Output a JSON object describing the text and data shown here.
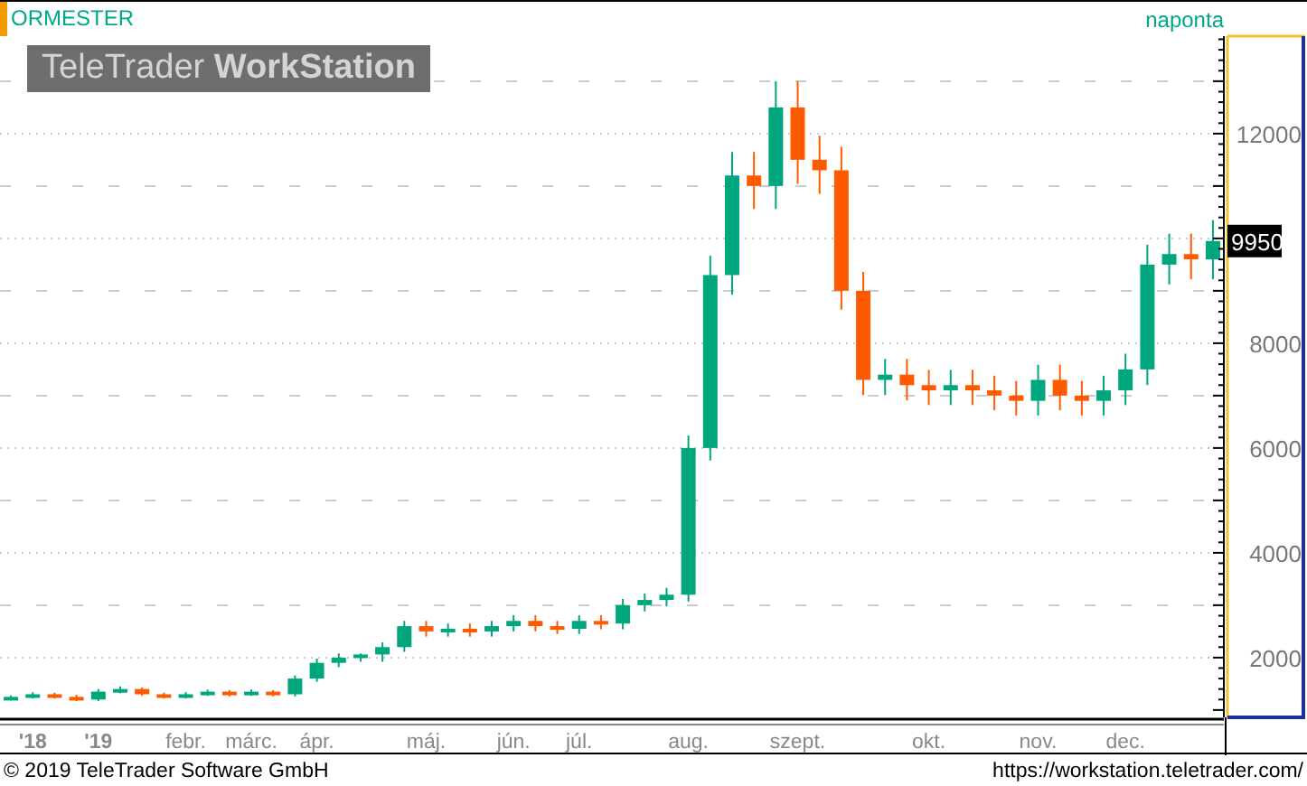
{
  "header": {
    "symbol": "ORMESTER",
    "interval": "naponta"
  },
  "logo": {
    "light": "TeleTrader",
    "bold": "WorkStation"
  },
  "chart": {
    "last_price": "9950",
    "chart_data": {
      "type": "candlestick",
      "categories": [
        null,
        "'18",
        null,
        null,
        "'19",
        null,
        null,
        null,
        "febr.",
        null,
        null,
        "márc.",
        null,
        null,
        "ápr.",
        null,
        null,
        null,
        null,
        "máj.",
        null,
        null,
        null,
        "jún.",
        null,
        null,
        "júl.",
        null,
        null,
        null,
        null,
        "aug.",
        null,
        null,
        null,
        null,
        "szept.",
        null,
        null,
        null,
        null,
        null,
        "okt.",
        null,
        null,
        null,
        null,
        "nov.",
        null,
        null,
        null,
        "dec.",
        null,
        null,
        null,
        null
      ],
      "ohlc": [
        [
          1220,
          1280,
          1180,
          1250
        ],
        [
          1250,
          1340,
          1220,
          1300
        ],
        [
          1300,
          1330,
          1220,
          1250
        ],
        [
          1250,
          1290,
          1170,
          1200
        ],
        [
          1200,
          1400,
          1170,
          1350
        ],
        [
          1350,
          1450,
          1320,
          1400
        ],
        [
          1400,
          1430,
          1270,
          1300
        ],
        [
          1300,
          1330,
          1220,
          1250
        ],
        [
          1250,
          1340,
          1220,
          1300
        ],
        [
          1300,
          1390,
          1270,
          1350
        ],
        [
          1350,
          1380,
          1260,
          1300
        ],
        [
          1300,
          1390,
          1270,
          1350
        ],
        [
          1350,
          1380,
          1260,
          1300
        ],
        [
          1300,
          1660,
          1260,
          1600
        ],
        [
          1600,
          1980,
          1540,
          1900
        ],
        [
          1900,
          2080,
          1820,
          2000
        ],
        [
          2000,
          2080,
          1920,
          2060
        ],
        [
          2060,
          2290,
          1920,
          2200
        ],
        [
          2200,
          2700,
          2110,
          2600
        ],
        [
          2600,
          2700,
          2400,
          2500
        ],
        [
          2500,
          2650,
          2400,
          2550
        ],
        [
          2550,
          2650,
          2400,
          2500
        ],
        [
          2500,
          2700,
          2400,
          2600
        ],
        [
          2600,
          2810,
          2500,
          2700
        ],
        [
          2700,
          2810,
          2500,
          2600
        ],
        [
          2600,
          2700,
          2450,
          2550
        ],
        [
          2550,
          2810,
          2450,
          2700
        ],
        [
          2700,
          2810,
          2540,
          2650
        ],
        [
          2650,
          3120,
          2540,
          3000
        ],
        [
          3000,
          3220,
          2880,
          3100
        ],
        [
          3100,
          3330,
          2980,
          3200
        ],
        [
          3200,
          6240,
          3070,
          6000
        ],
        [
          6000,
          9670,
          5760,
          9300
        ],
        [
          9300,
          11650,
          8930,
          11200
        ],
        [
          11200,
          11650,
          10560,
          11000
        ],
        [
          11000,
          13000,
          10560,
          12500
        ],
        [
          12500,
          13000,
          11040,
          11500
        ],
        [
          11500,
          11960,
          10850,
          11300
        ],
        [
          11300,
          11750,
          8640,
          9000
        ],
        [
          9000,
          9360,
          7010,
          7300
        ],
        [
          7300,
          7700,
          7010,
          7400
        ],
        [
          7400,
          7700,
          6910,
          7200
        ],
        [
          7200,
          7490,
          6820,
          7100
        ],
        [
          7100,
          7490,
          6820,
          7200
        ],
        [
          7200,
          7490,
          6820,
          7100
        ],
        [
          7100,
          7380,
          6720,
          7000
        ],
        [
          7000,
          7280,
          6620,
          6900
        ],
        [
          6900,
          7590,
          6620,
          7300
        ],
        [
          7300,
          7590,
          6720,
          7000
        ],
        [
          7000,
          7280,
          6620,
          6900
        ],
        [
          6900,
          7380,
          6620,
          7100
        ],
        [
          7100,
          7800,
          6820,
          7500
        ],
        [
          7500,
          9880,
          7200,
          9500
        ],
        [
          9500,
          10090,
          9120,
          9700
        ],
        [
          9700,
          10090,
          9220,
          9600
        ],
        [
          9600,
          10350,
          9220,
          9950
        ]
      ],
      "grid": true,
      "ylim": [
        860,
        13860
      ],
      "yticks": [
        2000,
        4000,
        6000,
        8000,
        12000
      ]
    }
  },
  "footer": {
    "copyright": "© 2019 TeleTrader Software GmbH",
    "url": "https://workstation.teletrader.com/"
  }
}
